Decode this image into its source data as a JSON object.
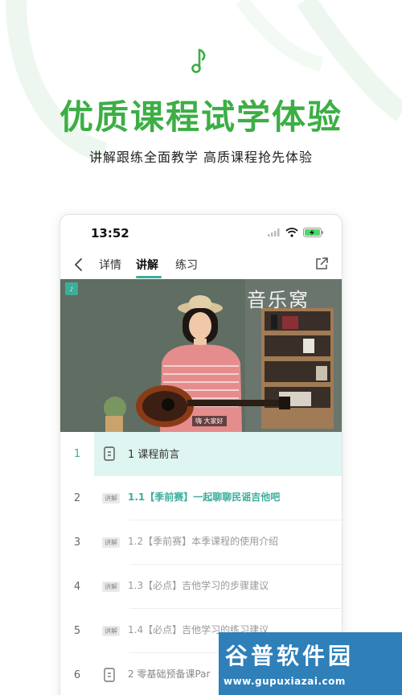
{
  "promo": {
    "headline": "优质课程试学体验",
    "subline": "讲解跟练全面教学 高质课程抢先体验",
    "accent_color": "#3cae45",
    "icon": "music-note-icon"
  },
  "status_bar": {
    "time": "13:52",
    "icons": [
      "signal-icon",
      "wifi-icon",
      "battery-charging-icon"
    ]
  },
  "nav": {
    "tabs": [
      {
        "label": "详情"
      },
      {
        "label": "讲解"
      },
      {
        "label": "练习"
      }
    ],
    "active_tab": "讲解",
    "accent_color": "#3cae9a"
  },
  "video": {
    "sign_text": "音乐窝",
    "subtitle": "嗨 大家好"
  },
  "lessons": [
    {
      "num": "1",
      "type": "chapter",
      "title": "1 课程前言"
    },
    {
      "num": "2",
      "type": "lesson",
      "badge": "讲解",
      "title": "1.1【季前赛】一起聊聊民谣吉他吧",
      "current": true
    },
    {
      "num": "3",
      "type": "lesson",
      "badge": "讲解",
      "title": "1.2【季前赛】本季课程的使用介绍"
    },
    {
      "num": "4",
      "type": "lesson",
      "badge": "讲解",
      "title": "1.3【必点】吉他学习的步骤建议"
    },
    {
      "num": "5",
      "type": "lesson",
      "badge": "讲解",
      "title": "1.4【必点】吉他学习的练习建议"
    },
    {
      "num": "6",
      "type": "chapter",
      "title": "2 零基础预备课Par"
    }
  ],
  "watermark": {
    "text": "谷普软件园",
    "url": "www.gupuxiazai.com"
  }
}
